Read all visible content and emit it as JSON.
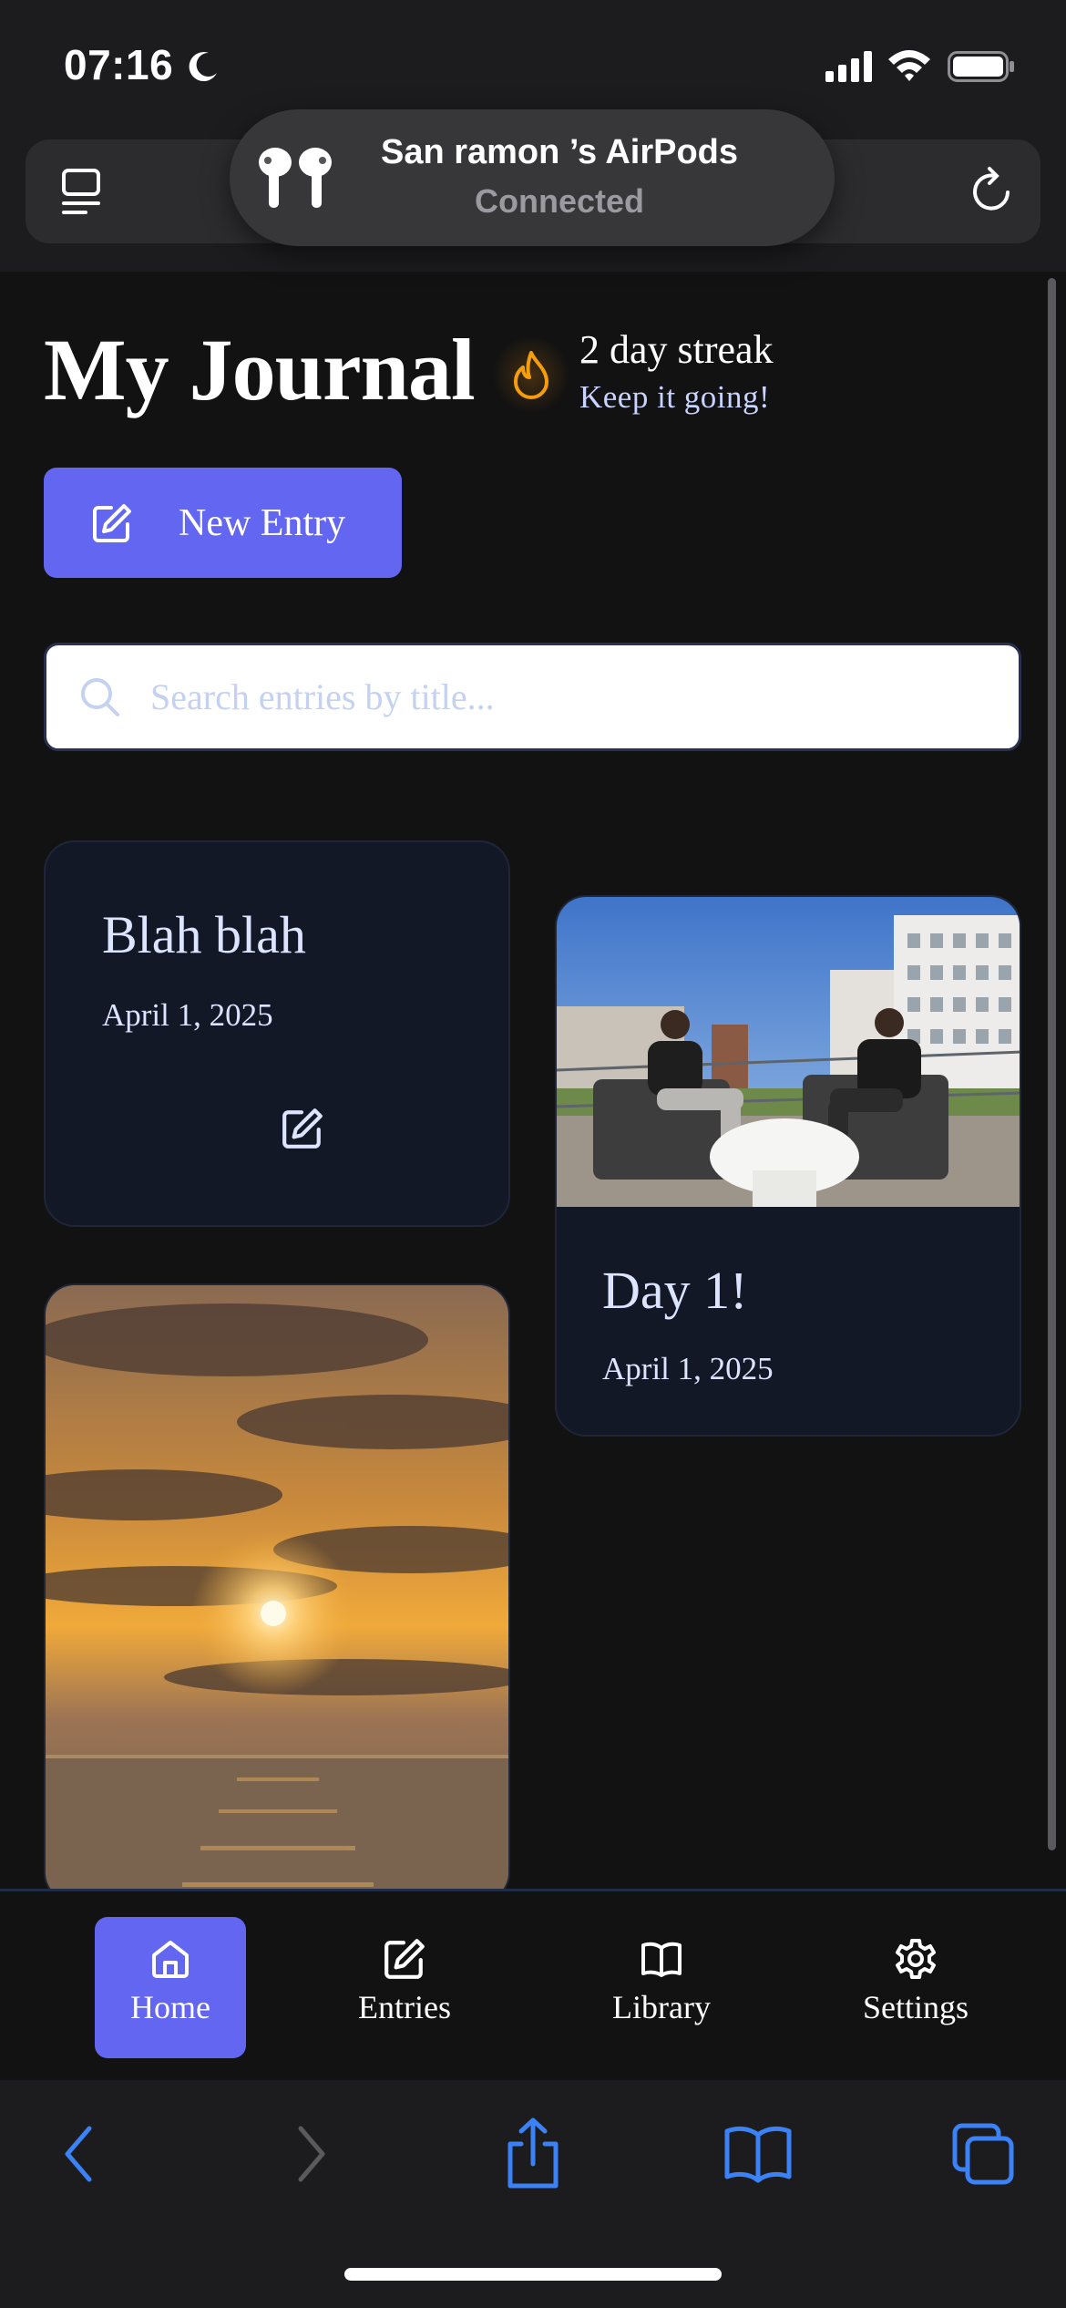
{
  "status_bar": {
    "time": "07:16",
    "icons": [
      "moon-icon",
      "cellular-signal-icon",
      "wifi-icon",
      "battery-icon"
    ]
  },
  "airpods_banner": {
    "title": "San ramon ’s AirPods",
    "status": "Connected",
    "icon": "airpods-icon"
  },
  "browser_top": {
    "icons": [
      "reader-icon",
      "reload-icon"
    ]
  },
  "header": {
    "title": "My Journal",
    "streak_title": "2 day streak",
    "streak_subtitle": "Keep it going!",
    "streak_icon": "flame-icon"
  },
  "new_entry": {
    "label": "New Entry",
    "icon": "pencil-square-icon"
  },
  "search": {
    "placeholder": "Search entries by title...",
    "value": ""
  },
  "entries": [
    {
      "title": "Blah blah",
      "date": "April 1, 2025",
      "has_photo": false
    },
    {
      "title": "Day 1!",
      "date": "April 1, 2025",
      "has_photo": true
    },
    {
      "title": "",
      "date": "",
      "has_photo": true
    }
  ],
  "bottom_nav": {
    "items": [
      {
        "label": "Home",
        "icon": "home-icon",
        "active": true
      },
      {
        "label": "Entries",
        "icon": "pencil-square-icon",
        "active": false
      },
      {
        "label": "Library",
        "icon": "book-open-icon",
        "active": false
      },
      {
        "label": "Settings",
        "icon": "gear-icon",
        "active": false
      }
    ]
  },
  "browser_toolbar": {
    "icons": [
      "back-icon",
      "forward-icon",
      "share-icon",
      "bookmarks-icon",
      "tabs-icon"
    ]
  },
  "colors": {
    "accent": "#6366f1",
    "background": "#121212",
    "card": "#121826",
    "streak": "#f59e0b",
    "safari_blue": "#3b82f6"
  }
}
